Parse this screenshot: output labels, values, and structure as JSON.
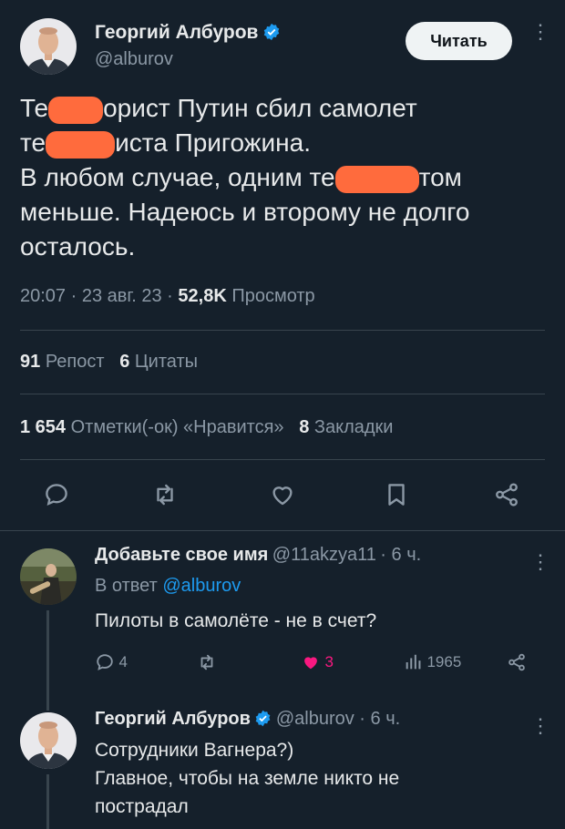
{
  "main_tweet": {
    "author_name": "Георгий Албуров",
    "author_handle": "@alburov",
    "follow_label": "Читать",
    "text_lines": [
      {
        "pre": "Те",
        "post": "орист Путин сбил самолет"
      },
      {
        "pre": "те",
        "post": "иста Пригожина."
      },
      {
        "pre": "В любом случае, одним те",
        "post": "том"
      },
      {
        "pre": "меньше. Надеюсь и второму не долго",
        "post": ""
      },
      {
        "pre": "осталось.",
        "post": ""
      }
    ],
    "time": "20:07",
    "date": "23 авг. 23",
    "views_count": "52,8K",
    "views_label": "Просмотр",
    "reposts_count": "91",
    "reposts_label": "Репост",
    "quotes_count": "6",
    "quotes_label": "Цитаты",
    "likes_count": "1 654",
    "likes_label": "Отметки(-ок) «Нравится»",
    "bookmarks_count": "8",
    "bookmarks_label": "Закладки"
  },
  "reply1": {
    "author_name": "Добавьте свое имя",
    "author_handle": "@11akzya11",
    "age": "6 ч.",
    "reply_to_prefix": "В ответ",
    "reply_to_handle": "@alburov",
    "text": "Пилоты в самолёте - не в счет?",
    "reply_count": "4",
    "like_count": "3",
    "view_count": "1965"
  },
  "reply2": {
    "author_name": "Георгий Албуров",
    "author_handle": "@alburov",
    "age": "6 ч.",
    "text_lines": [
      "Сотрудники Вагнера?)",
      "Главное, чтобы на земле никто не",
      "пострадал"
    ]
  },
  "colors": {
    "background": "#15202b",
    "accent": "#1d9bf0",
    "like": "#f91880",
    "redaction": "#ff6b3d"
  }
}
